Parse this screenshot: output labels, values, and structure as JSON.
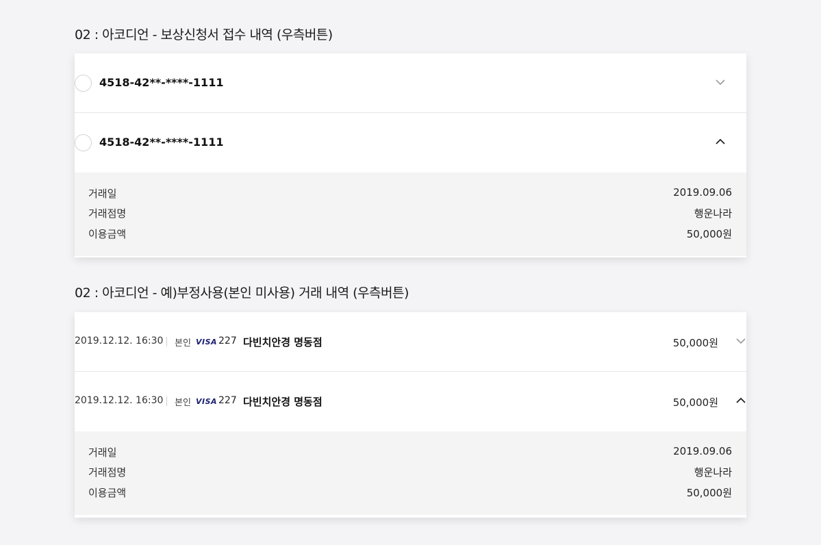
{
  "section1": {
    "title": "02 : 아코디언 - 보상신청서 접수 내역 (우측버튼)",
    "items": [
      {
        "card_number": "4518-42**-****-1111",
        "expanded": false,
        "toggle_icon": "chevron-down-icon"
      },
      {
        "card_number": "4518-42**-****-1111",
        "expanded": true,
        "toggle_icon": "chevron-up-icon"
      }
    ],
    "details": [
      {
        "label": "거래일",
        "value": "2019.09.06"
      },
      {
        "label": "거래점명",
        "value": "행운나라"
      },
      {
        "label": "이용금액",
        "value": "50,000원"
      }
    ]
  },
  "section2": {
    "title": "02 :  아코디언 - 예)부정사용(본인 미사용) 거래 내역 (우측버튼)",
    "items": [
      {
        "datetime": "2019.12.12. 16:30",
        "owner": "본인",
        "brand": "VISA",
        "card_suffix": "227",
        "merchant": "다빈치안경 명동점",
        "amount": "50,000원",
        "expanded": false,
        "toggle_icon": "chevron-down-icon"
      },
      {
        "datetime": "2019.12.12. 16:30",
        "owner": "본인",
        "brand": "VISA",
        "card_suffix": "227",
        "merchant": "다빈치안경 명동점",
        "amount": "50,000원",
        "expanded": true,
        "toggle_icon": "chevron-up-icon"
      }
    ],
    "details": [
      {
        "label": "거래일",
        "value": "2019.09.06"
      },
      {
        "label": "거래점명",
        "value": "행운나라"
      },
      {
        "label": "이용금액",
        "value": "50,000원"
      }
    ]
  },
  "colors": {
    "page_bg": "#f4f4f6",
    "details_bg": "#f4f4f4",
    "visa_brand": "#1a1f71"
  }
}
